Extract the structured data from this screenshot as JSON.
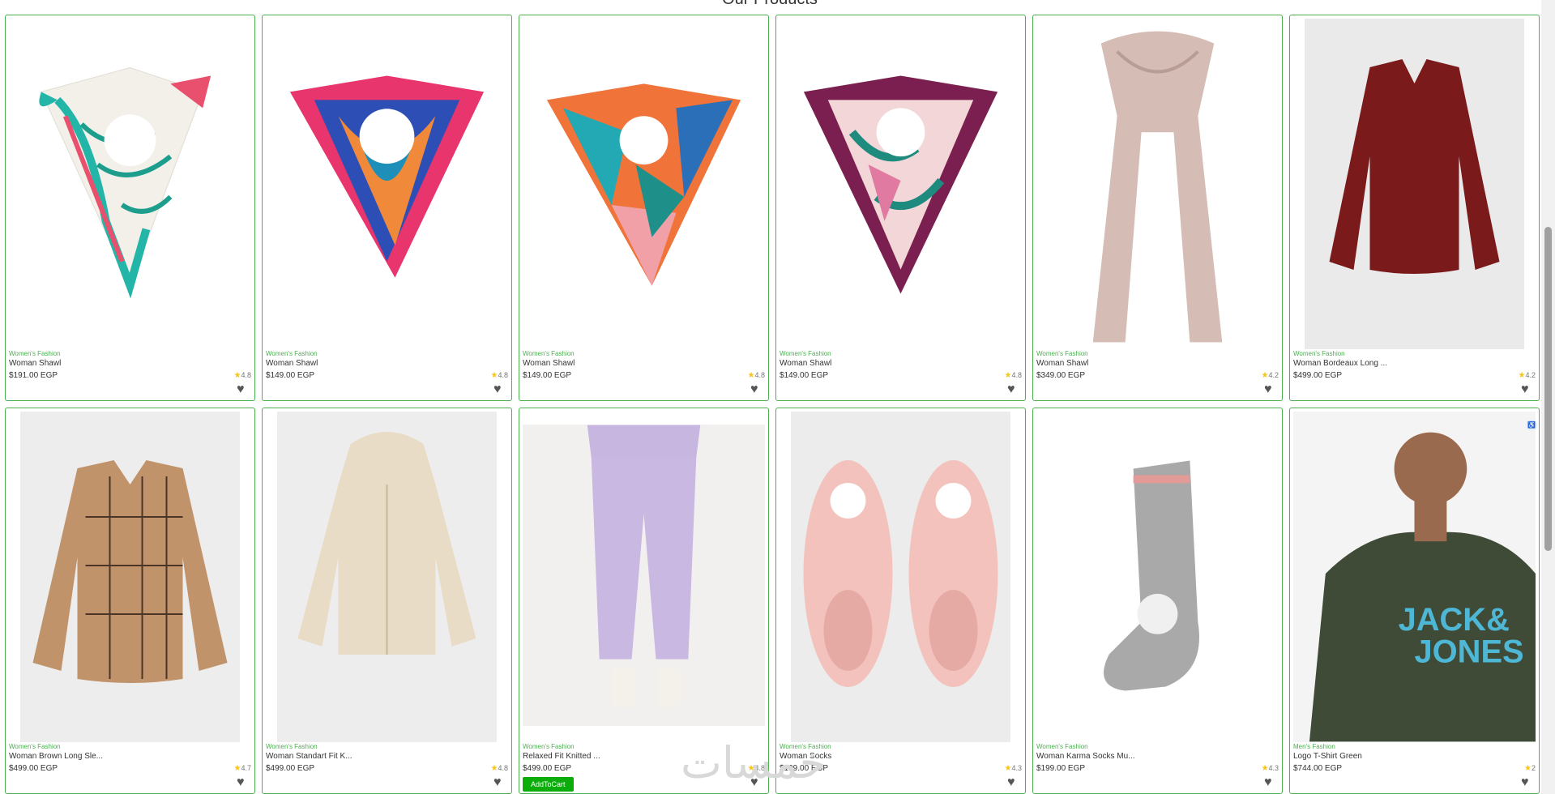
{
  "page": {
    "heading": "Our Products",
    "watermark": "خمسات"
  },
  "products": [
    {
      "category": "Women's Fashion",
      "title": "Woman Shawl",
      "price": "$191.00 EGP",
      "rating": "4.8",
      "image": "floral-scarf-white-teal"
    },
    {
      "category": "Women's Fashion",
      "title": "Woman Shawl",
      "price": "$149.00 EGP",
      "rating": "4.8",
      "image": "scarf-pink-blue"
    },
    {
      "category": "Women's Fashion",
      "title": "Woman Shawl",
      "price": "$149.00 EGP",
      "rating": "4.8",
      "image": "scarf-geometric-orange-teal"
    },
    {
      "category": "Women's Fashion",
      "title": "Woman Shawl",
      "price": "$149.00 EGP",
      "rating": "4.8",
      "image": "scarf-plum-floral"
    },
    {
      "category": "Women's Fashion",
      "title": "Woman Shawl",
      "price": "$349.00 EGP",
      "rating": "4.2",
      "image": "long-scarf-beige"
    },
    {
      "category": "Women's Fashion",
      "title": "Woman Bordeaux Long ...",
      "price": "$499.00 EGP",
      "rating": "4.2",
      "image": "bordeaux-shirt"
    },
    {
      "category": "Women's Fashion",
      "title": "Woman Brown Long Sle...",
      "price": "$499.00 EGP",
      "rating": "4.7",
      "image": "plaid-brown-shirt"
    },
    {
      "category": "Women's Fashion",
      "title": "Woman Standart Fit K...",
      "price": "$499.00 EGP",
      "rating": "4.8",
      "image": "cream-hoodie"
    },
    {
      "category": "Women's Fashion",
      "title": "Relaxed Fit Knitted ...",
      "price": "$499.00 EGP",
      "rating": "4.8",
      "image": "lilac-sweatpants",
      "add_to_cart": "AddToCart"
    },
    {
      "category": "Women's Fashion",
      "title": "Woman Socks",
      "price": "$199.00 EGP",
      "rating": "4.3",
      "image": "pink-fluffy-socks"
    },
    {
      "category": "Women's Fashion",
      "title": "Woman Karma Socks Mu...",
      "price": "$199.00 EGP",
      "rating": "4.3",
      "image": "grey-bunny-sock"
    },
    {
      "category": "Men's Fashion",
      "title": "Logo T-Shirt Green",
      "price": "$744.00 EGP",
      "rating": "2",
      "image": "jack-jones-tshirt"
    }
  ],
  "colors": {
    "accent": "#4caf50",
    "button": "#0aad0a",
    "star": "#f5c518"
  }
}
